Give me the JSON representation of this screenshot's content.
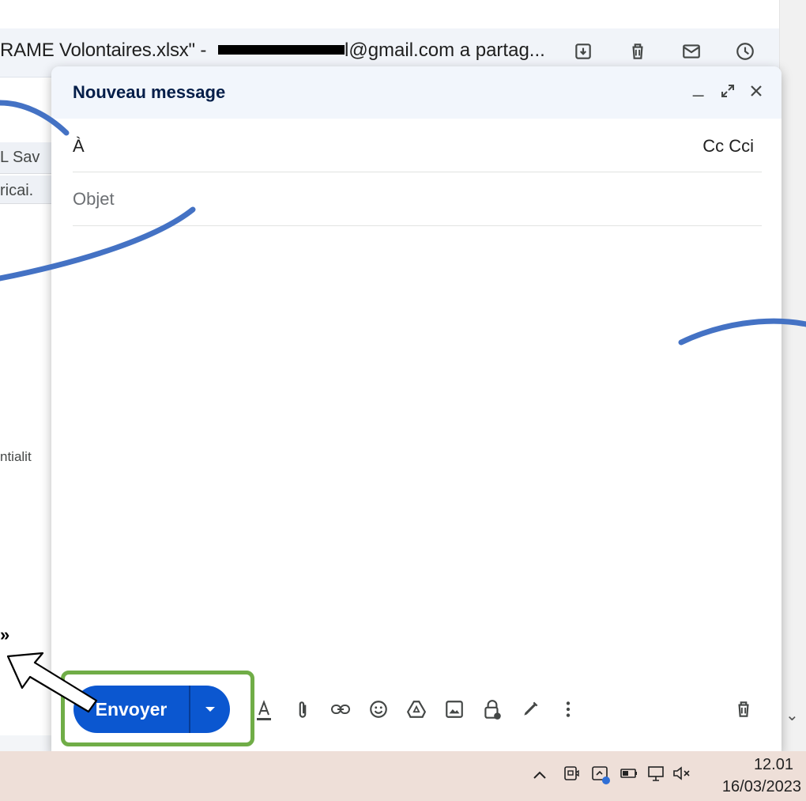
{
  "email_header": {
    "subject_part": "RAME Volontaires.xlsx\" -",
    "sender_part": "l@gmail.com a partag..."
  },
  "background": {
    "row1_text": "L Sav",
    "row2_text": "ricai.",
    "confidential_text": "ntialit",
    "quote_fragment": "»"
  },
  "compose": {
    "title": "Nouveau message",
    "minimize_label": "_",
    "to_label": "À",
    "cc_cci_label": "Cc Cci",
    "subject_placeholder": "Objet",
    "send_label": "Envoyer"
  },
  "taskbar": {
    "time": "12.01",
    "date": "16/03/2023"
  },
  "colors": {
    "send_button": "#0b57d0",
    "compose_header": "#f2f6fc",
    "annotation_curve": "#4472c4",
    "highlight_box": "#70ad47",
    "taskbar": "#eedfd8"
  },
  "icons": {
    "header": [
      "archive-icon",
      "trash-icon",
      "mail-icon",
      "snooze-clock-icon"
    ],
    "compose_controls": [
      "minimize-icon",
      "expand-icon",
      "close-icon"
    ],
    "toolbar": [
      "text-format-icon",
      "attach-icon",
      "link-icon",
      "emoji-icon",
      "drive-icon",
      "photo-icon",
      "confidential-lock-icon",
      "signature-pen-icon",
      "more-options-icon",
      "discard-trash-icon"
    ],
    "tray": [
      "chevron-up-icon",
      "meet-icon",
      "screen-share-icon",
      "battery-icon",
      "network-icon",
      "volume-muted-icon"
    ]
  }
}
